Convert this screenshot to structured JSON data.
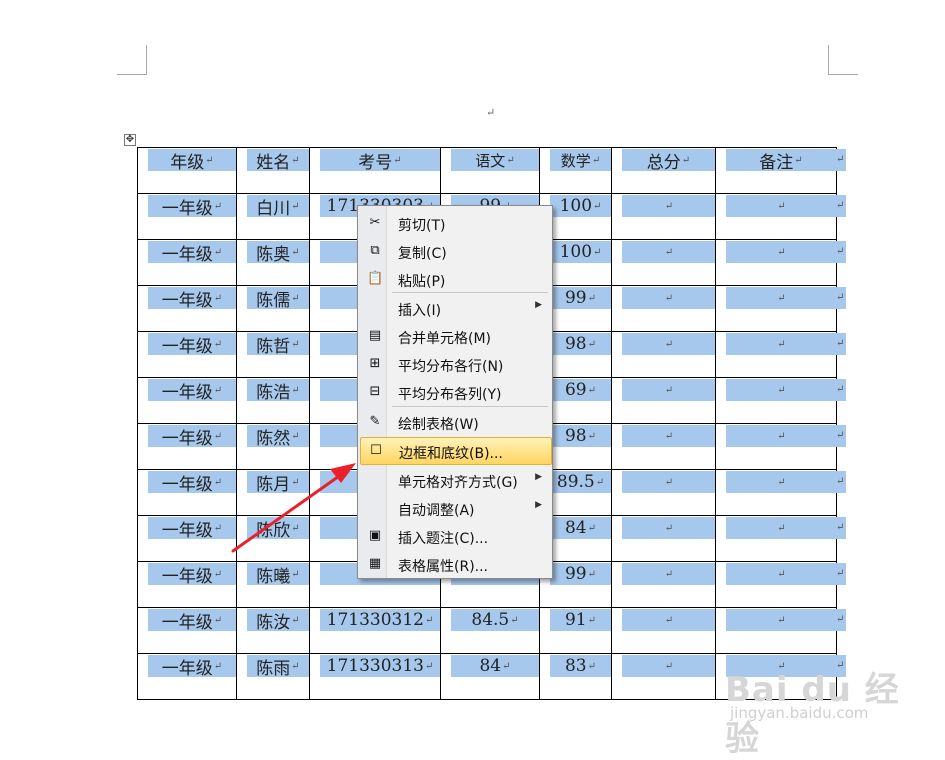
{
  "document": {
    "paragraph_mark": "↵",
    "move_handle": "✥",
    "table": {
      "header": [
        "年级",
        "姓名",
        "考号",
        "语文",
        "数学",
        "总分",
        "备注"
      ],
      "rows": [
        [
          "一年级",
          "白川",
          "171330303",
          "99",
          "100",
          "",
          ""
        ],
        [
          "一年级",
          "陈奥",
          "171",
          "",
          "100",
          "",
          ""
        ],
        [
          "一年级",
          "陈儒",
          "171",
          "",
          "99",
          "",
          ""
        ],
        [
          "一年级",
          "陈哲",
          "171",
          "",
          "98",
          "",
          ""
        ],
        [
          "一年级",
          "陈浩",
          "171",
          "",
          "69",
          "",
          ""
        ],
        [
          "一年级",
          "陈然",
          "171",
          "",
          "98",
          "",
          ""
        ],
        [
          "一年级",
          "陈月",
          "171",
          "",
          "89.5",
          "",
          ""
        ],
        [
          "一年级",
          "陈欣",
          "171",
          "",
          "84",
          "",
          ""
        ],
        [
          "一年级",
          "陈曦",
          "171",
          "",
          "99",
          "",
          ""
        ],
        [
          "一年级",
          "陈汝",
          "171330312",
          "84.5",
          "91",
          "",
          ""
        ],
        [
          "一年级",
          "陈雨",
          "171330313",
          "84",
          "83",
          "",
          ""
        ]
      ]
    }
  },
  "context_menu": {
    "items": [
      {
        "label": "剪切(T)",
        "icon": "scissors-icon",
        "glyph": "✂"
      },
      {
        "label": "复制(C)",
        "icon": "copy-icon",
        "glyph": "⧉"
      },
      {
        "label": "粘贴(P)",
        "icon": "paste-icon",
        "glyph": "📋"
      },
      {
        "label": "插入(I)",
        "icon": "",
        "glyph": "",
        "submenu": true
      },
      {
        "label": "合并单元格(M)",
        "icon": "merge-cells-icon",
        "glyph": "▤"
      },
      {
        "label": "平均分布各行(N)",
        "icon": "distribute-rows-icon",
        "glyph": "⊞"
      },
      {
        "label": "平均分布各列(Y)",
        "icon": "distribute-columns-icon",
        "glyph": "⊟"
      },
      {
        "label": "绘制表格(W)",
        "icon": "draw-table-icon",
        "glyph": "✎"
      },
      {
        "label": "边框和底纹(B)...",
        "icon": "borders-shading-icon",
        "glyph": "☐",
        "highlighted": true
      },
      {
        "label": "单元格对齐方式(G)",
        "icon": "",
        "glyph": "",
        "submenu": true
      },
      {
        "label": "自动调整(A)",
        "icon": "",
        "glyph": "",
        "submenu": true
      },
      {
        "label": "插入题注(C)...",
        "icon": "insert-caption-icon",
        "glyph": "▣"
      },
      {
        "label": "表格属性(R)...",
        "icon": "table-properties-icon",
        "glyph": "▦"
      }
    ],
    "submenu_glyph": "▶"
  },
  "annotation": {
    "color": "#e8212b"
  },
  "watermark": {
    "brand": "Bai du 经验",
    "url": "jingyan.baidu.com"
  },
  "colors": {
    "cell_highlight": "#a6c8ec",
    "menu_highlight": "#ffd560"
  }
}
